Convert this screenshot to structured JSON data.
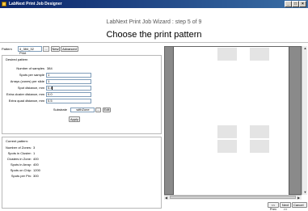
{
  "window": {
    "title": "LabNext Print Job Designer",
    "minimize_glyph": "_",
    "maximize_glyph": "□",
    "close_glyph": "×"
  },
  "wizard": {
    "step": "LabNext Print Job Wizard : step 5 of 9",
    "title": "Choose the print pattern"
  },
  "pattern_bar": {
    "label": "Pattern",
    "value": "4_384_32 Print",
    "browse_label": "...",
    "new_label": "New",
    "advanced_label": "Advanced"
  },
  "desired": {
    "title": "Desired pattern",
    "number_of_samples_label": "Number of samples",
    "number_of_samples_value": "384",
    "spots_per_sample_label": "Spots per sample",
    "spots_per_sample_value": "1",
    "arrays_per_slide_label": "Arrays (zones) per slide",
    "arrays_per_slide_value": "1",
    "spot_distance_label": "Spot distance, mm",
    "spot_distance_value": "0.4",
    "extra_cluster_label": "Extra cluster distance, mm",
    "extra_cluster_value": "0.0",
    "extra_quad_label": "Extra quad distance, mm",
    "extra_quad_value": "0.5",
    "substrate_label": "Substrate",
    "substrate_value": "withZone",
    "substrate_browse": "...",
    "edit_label": "Edit",
    "apply_label": "Apply"
  },
  "current": {
    "title": "Current pattern:",
    "rows": [
      {
        "label": "Number of Zones:",
        "value": "3"
      },
      {
        "label": "Spots in Cluster:",
        "value": "1"
      },
      {
        "label": "Clusters in Zone:",
        "value": "400"
      },
      {
        "label": "Spots in Array:",
        "value": "400"
      },
      {
        "label": "Spots on Chip:",
        "value": "1200"
      },
      {
        "label": "Spots per Pin:",
        "value": "300"
      }
    ]
  },
  "preview": {
    "scroll_up": "▲",
    "scroll_down": "▼",
    "scroll_left": "◀",
    "scroll_right": "▶"
  },
  "nav": {
    "prev_label": "<< Prev",
    "next_label": "Next >>",
    "cancel_label": "Cancel"
  }
}
